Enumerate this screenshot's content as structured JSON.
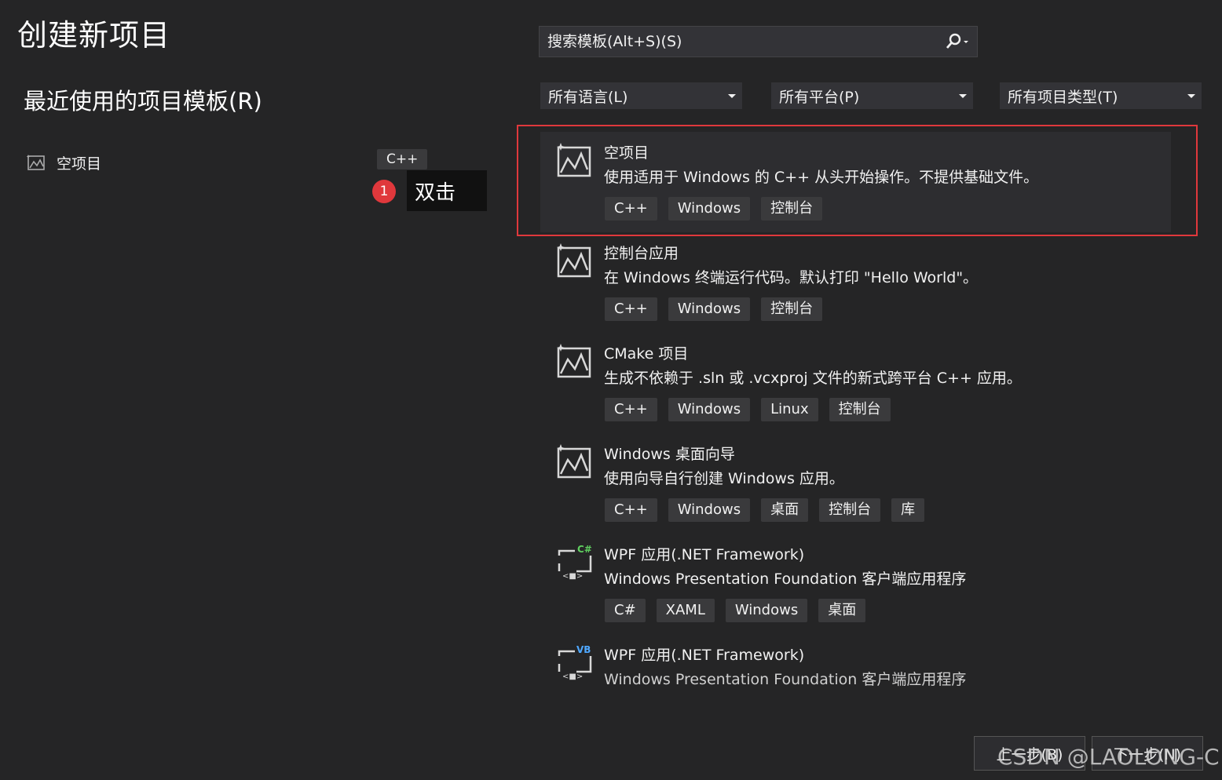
{
  "page_title": "创建新项目",
  "recent": {
    "heading": "最近使用的项目模板(R)",
    "items": [
      {
        "name": "空项目",
        "tag": "C++"
      }
    ]
  },
  "annotation": {
    "number": "1",
    "text": "双击"
  },
  "search": {
    "placeholder": "搜索模板(Alt+S)(S)"
  },
  "filters": {
    "language": "所有语言(L)",
    "platform": "所有平台(P)",
    "project_type": "所有项目类型(T)"
  },
  "templates": [
    {
      "name": "空项目",
      "description": "使用适用于 Windows 的 C++ 从头开始操作。不提供基础文件。",
      "tags": [
        "C++",
        "Windows",
        "控制台"
      ],
      "icon": "cpp-project-icon"
    },
    {
      "name": "控制台应用",
      "description": "在 Windows 终端运行代码。默认打印 \"Hello World\"。",
      "tags": [
        "C++",
        "Windows",
        "控制台"
      ],
      "icon": "cpp-project-icon"
    },
    {
      "name": "CMake 项目",
      "description": "生成不依赖于 .sln 或 .vcxproj 文件的新式跨平台 C++ 应用。",
      "tags": [
        "C++",
        "Windows",
        "Linux",
        "控制台"
      ],
      "icon": "cpp-project-icon"
    },
    {
      "name": "Windows 桌面向导",
      "description": "使用向导自行创建 Windows 应用。",
      "tags": [
        "C++",
        "Windows",
        "桌面",
        "控制台",
        "库"
      ],
      "icon": "cpp-project-icon"
    },
    {
      "name": "WPF 应用(.NET Framework)",
      "description": "Windows Presentation Foundation 客户端应用程序",
      "tags": [
        "C#",
        "XAML",
        "Windows",
        "桌面"
      ],
      "icon": "wpf-csharp-icon",
      "badge": "C#"
    },
    {
      "name": "WPF 应用(.NET Framework)",
      "description": "Windows Presentation Foundation 客户端应用程序",
      "tags": [],
      "icon": "wpf-vb-icon",
      "badge": "VB"
    }
  ],
  "buttons": {
    "back": "上一步(B)",
    "next": "下一步(N)"
  },
  "watermark": "CSDN @LAOLONG-C",
  "colors": {
    "background": "#252526",
    "highlight": "#e0383c",
    "selected_bg": "#2d2d30",
    "tag_bg": "#3a3a3c"
  }
}
